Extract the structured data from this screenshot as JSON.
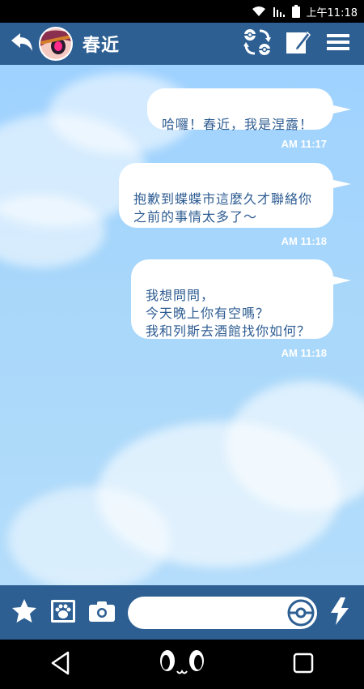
{
  "status_bar": {
    "time": "上午11:18"
  },
  "header": {
    "contact_name": "春近"
  },
  "messages": [
    {
      "text": "哈囉！春近，我是涅露！",
      "time": "AM 11:17"
    },
    {
      "text": "抱歉到蝶蝶市這麼久才聯絡你\n之前的事情太多了～",
      "time": "AM 11:18"
    },
    {
      "text": "我想問問，\n今天晚上你有空嗎？\n我和列斯去酒館找你如何？",
      "time": "AM 11:18"
    }
  ],
  "composer": {
    "value": ""
  },
  "colors": {
    "bar": "#2d5f93",
    "text": "#2e5c92",
    "sky": "#a8d7fa"
  },
  "icons": [
    "back-arrow-icon",
    "swap-icon",
    "compose-icon",
    "menu-icon",
    "star-icon",
    "paw-photo-icon",
    "camera-icon",
    "pokeball-icon",
    "lightning-icon",
    "nav-back-icon",
    "nav-home-icon",
    "nav-recents-icon"
  ]
}
